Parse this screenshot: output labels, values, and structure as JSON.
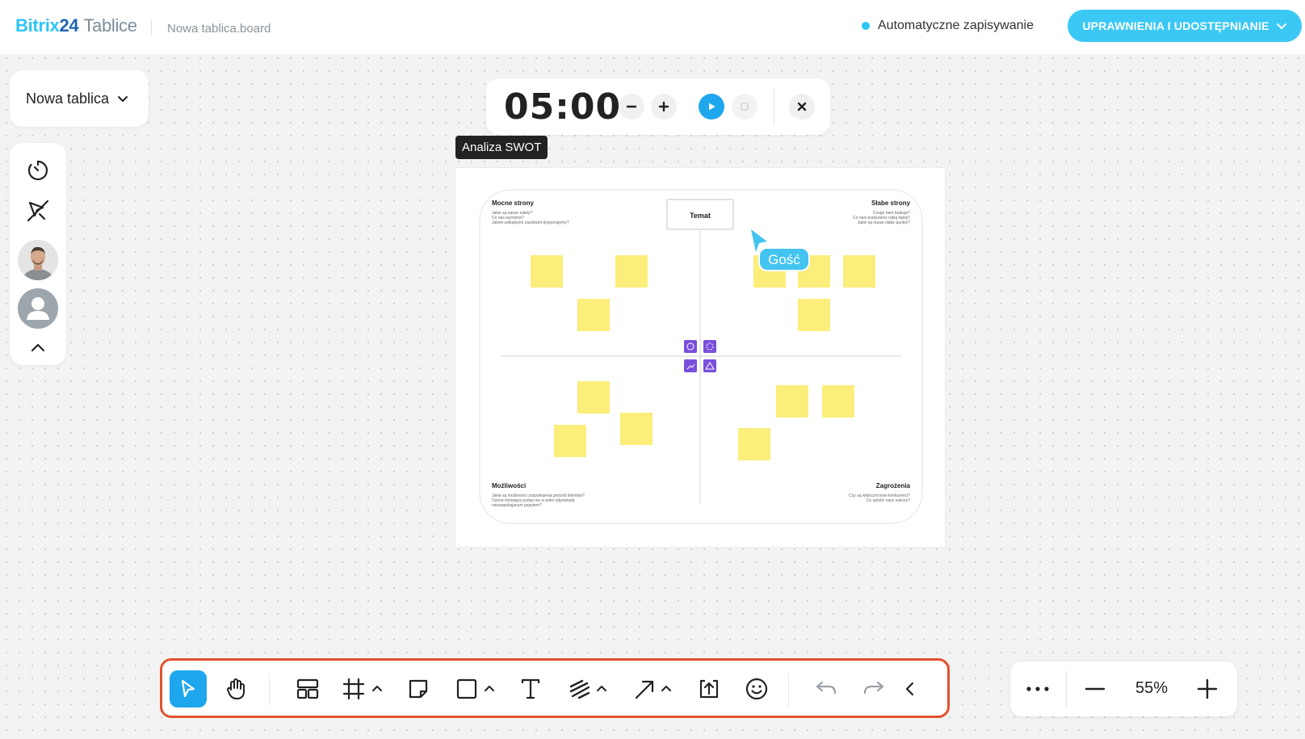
{
  "header": {
    "logo_brand_1": "Bitrix",
    "logo_brand_2": "24",
    "logo_product": "Tablice",
    "board_filename": "Nowa tablica.board",
    "autosave_label": "Automatyczne zapisywanie",
    "share_button": "UPRAWNIENIA I UDOSTĘPNIANIE"
  },
  "board_selector": {
    "label": "Nowa tablica"
  },
  "timer": {
    "value": "05:00"
  },
  "frame": {
    "label": "Analiza SWOT"
  },
  "swot": {
    "topic": "Temat",
    "strengths": {
      "title": "Mocne strony",
      "lines": [
        "Jakie są nasze zalety?",
        "Co nas wyróżnia?",
        "Jakimi unikalnymi zasobami dysponujemy?"
      ]
    },
    "weaknesses": {
      "title": "Słabe strony",
      "lines": [
        "Czego nam brakuje?",
        "Co nasi konkurenci robią lepiej?",
        "Jakie są nasze słabe punkty?"
      ]
    },
    "opportunities": {
      "title": "Możliwości",
      "lines": [
        "Jakie są możliwości zaspokojenia potrzeb klientów?",
        "Ozone istniejąca podaż nie w pełni odpowiada",
        "niezaspokajanym popytem?"
      ]
    },
    "threats": {
      "title": "Zagrożenia",
      "lines": [
        "Czy są widoczni nowi konkurenci?",
        "Co opóźni nasz sukces?"
      ]
    }
  },
  "cursor": {
    "user_label": "Gość",
    "color": "#44c4f0"
  },
  "zoom": {
    "value": "55%"
  },
  "colors": {
    "accent": "#2fc6f6",
    "toolbar_highlight": "#e2522c",
    "active_tool": "#1fa7ee",
    "sticky_note": "#fbee7a",
    "swot_icon": "#7a4fdc"
  }
}
